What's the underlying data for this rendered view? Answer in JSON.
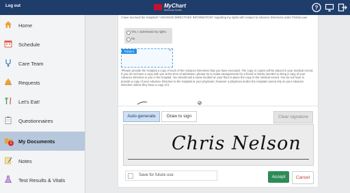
{
  "topbar": {
    "logout_label": "Log out",
    "logo_brand": "MyChart",
    "logo_sub": "Bethesda Health",
    "brand_color": "#1f3d6b",
    "icons": [
      "help-icon",
      "computer-icon",
      "exit-icon"
    ]
  },
  "sidebar": {
    "items": [
      {
        "label": "Home",
        "icon": "home-icon"
      },
      {
        "label": "Schedule",
        "icon": "calendar-icon"
      },
      {
        "label": "Care Team",
        "icon": "stethoscope-icon"
      },
      {
        "label": "Requests",
        "icon": "bell-icon"
      },
      {
        "label": "Let's Eat!",
        "icon": "utensils-icon"
      },
      {
        "label": "Questionnaires",
        "icon": "clipboard-icon"
      },
      {
        "label": "My Documents",
        "icon": "folder-icon",
        "badge": "1"
      },
      {
        "label": "Notes",
        "icon": "notepad-icon"
      },
      {
        "label": "Test Results & Vitals",
        "icon": "flask-icon"
      }
    ],
    "active_index": 6,
    "active_color": "#b7c7dc"
  },
  "document": {
    "top_text": "I have received the Hospital's \"ADVANCE DIRECTIVES INFORMATION\" regarding my rights with respect to Advance Directives under Florida Law.",
    "radio_yes": "Yes, I understand my rights.",
    "radio_no": "No",
    "patient_label": "Patient",
    "paragraph": "*Please provide the Hospital a copy of each of the Advance Directives that you have executed. The copy or copies will be placed in your medical record. If you do not have a copy with you at the time of admission, please try to make arrangements for a friend or family member to bring a copy of your Advance Directive to you in the hospital. You should ask a nurse located on your floor to place the copy in the medical record. You do not have to provide a copy of your Advance Directive to the Hospital or your physician; however a physician and/or the Hospital cannot rely on your Advance Directive unless they have a copy of it."
  },
  "signature": {
    "tab_auto": "Auto-generate",
    "tab_draw": "Draw to sign",
    "clear_label": "Clear signature",
    "signature_text": "Chris Nelson",
    "save_label": "Save for future use",
    "accept_label": "Accept",
    "cancel_label": "Cancel",
    "accept_color": "#2e8b57",
    "cancel_color": "#c0392b"
  }
}
